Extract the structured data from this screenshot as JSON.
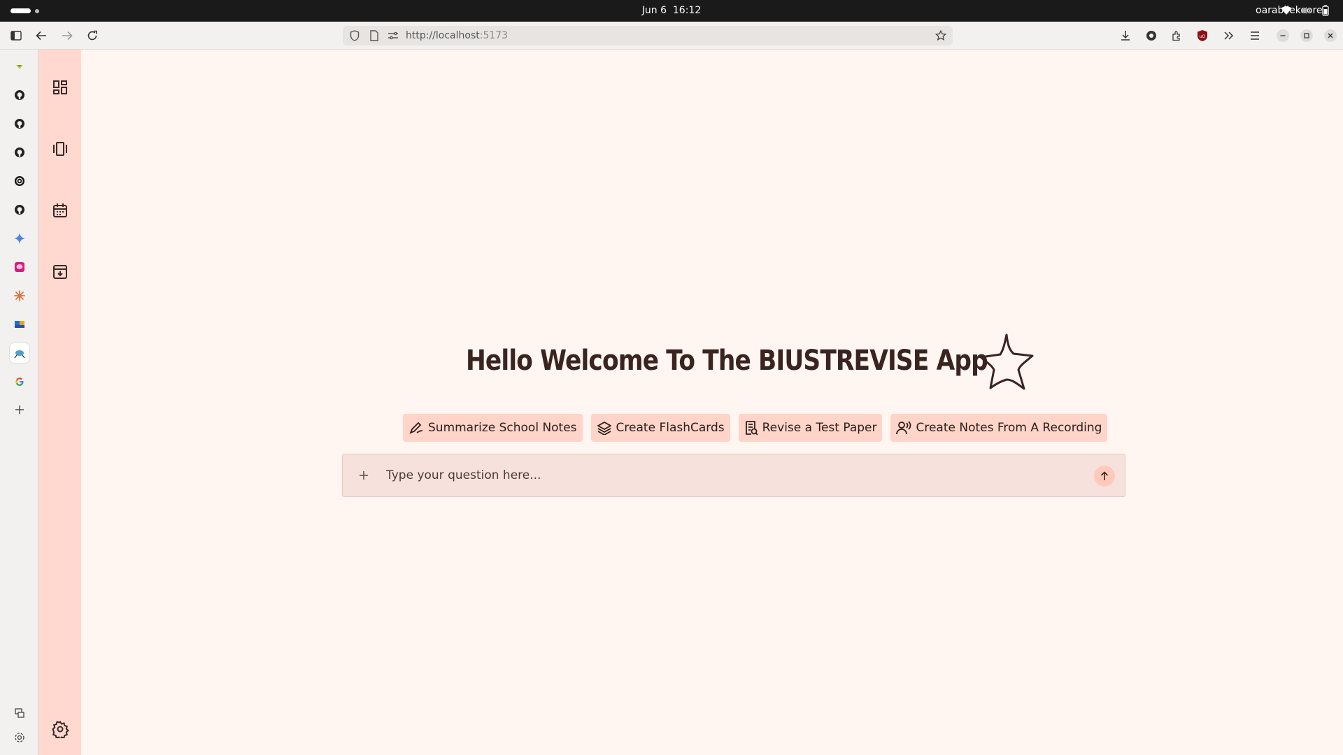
{
  "os": {
    "date": "Jun 6",
    "time": "16:12",
    "user": "oarabilekoore"
  },
  "browser": {
    "url_host": "http://localhost",
    "url_port": ":5173",
    "sidebar_items": [
      {
        "icon": "bookmark-icon"
      },
      {
        "icon": "github-icon"
      },
      {
        "icon": "github-icon"
      },
      {
        "icon": "github-icon"
      },
      {
        "icon": "openai-icon"
      },
      {
        "icon": "github-icon"
      },
      {
        "icon": "gemini-icon"
      },
      {
        "icon": "chat-app-icon"
      },
      {
        "icon": "claude-icon"
      },
      {
        "icon": "app-icon"
      },
      {
        "icon": "bird-app-icon"
      },
      {
        "icon": "google-icon"
      },
      {
        "icon": "add-icon"
      }
    ]
  },
  "app": {
    "welcome_title": "Hello Welcome To The BIUSTREVISE App",
    "actions": [
      {
        "label": "Summarize School Notes",
        "icon": "pen-icon"
      },
      {
        "label": "Create FlashCards",
        "icon": "layers-icon"
      },
      {
        "label": "Revise a Test Paper",
        "icon": "document-icon"
      },
      {
        "label": "Create Notes From A Recording",
        "icon": "voice-icon"
      }
    ],
    "question_placeholder": "Type your question here...",
    "colors": {
      "background": "#fff5f1",
      "sidebar": "#ffd8cf",
      "button": "#ffd4c9",
      "text": "#3a2420"
    }
  }
}
